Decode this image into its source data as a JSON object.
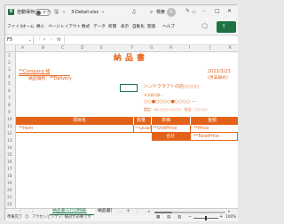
{
  "titlebar": {
    "autosave": "自動保存",
    "toggle": "オフ",
    "filename": "3-Detail.xlsx",
    "search": "検索",
    "user": "A"
  },
  "ribbon": {
    "tabs": [
      "ファイル",
      "ホーム",
      "挿入",
      "ページ",
      "レイアウト",
      "数式",
      "データ",
      "校閲",
      "表示",
      "自動化",
      "開発",
      "ヘルプ"
    ]
  },
  "formula": {
    "namebox": "F5",
    "fx": "fx"
  },
  "columns": [
    "A",
    "B",
    "C",
    "D",
    "E",
    "F",
    "G",
    "H",
    "I",
    "J",
    "K"
  ],
  "rows": [
    "1",
    "2",
    "3",
    "4",
    "5",
    "6",
    "7",
    "8",
    "9",
    "10",
    "11",
    "12",
    "13",
    "14",
    "15",
    "16",
    "17",
    "18",
    "19",
    "20",
    "21",
    "22"
  ],
  "sheet": {
    "title": "納品書",
    "company": "**Company 様",
    "delivery_line": "納品場所：**Delivery",
    "date": "2023/3/23",
    "date_note": "(月末締め)",
    "vendor_name": "ハンドクラフトの店○○○○",
    "vendor_zip": "〒336-00--",
    "vendor_addr": "○○●○○○○●○○○○ ---",
    "vendor_tel": "電話：03-○○○-○○○○　担当：○○ ○○",
    "header_item": "項目名",
    "header_qty": "数量",
    "header_unit": "単価",
    "header_amount": "金額",
    "item": "**Item",
    "qty": "**Quan",
    "unit_price": "**UnitPrice",
    "price": "**Price",
    "total_label": "合計",
    "total": "**TotalPrice"
  },
  "tabs": {
    "active": "納品書(1行1明細)",
    "second": "納品書(",
    "add": "+"
  },
  "status": {
    "ready": "準備完了",
    "accessibility": "アクセシビリティ: 検討が必要です",
    "zoom": "100%"
  },
  "colors": {
    "accent": "#e2621a",
    "excel": "#1e7145"
  }
}
